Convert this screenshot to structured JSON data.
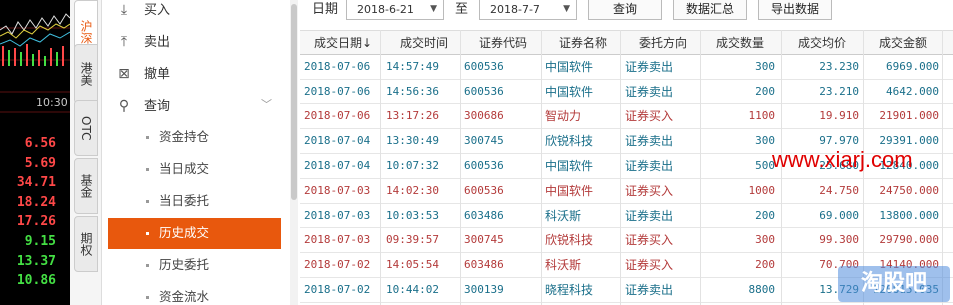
{
  "left_panel": {
    "time": "10:30",
    "prices": [
      "6.56",
      "5.69",
      "34.71",
      "18.24",
      "17.26",
      "9.15",
      "13.37",
      "10.86"
    ],
    "price_colors": [
      "#ff4848",
      "#ff4848",
      "#ff4848",
      "#ff4848",
      "#ff4848",
      "#44e044",
      "#44e044",
      "#44e044"
    ]
  },
  "vtabs": [
    {
      "label": "沪深",
      "active": true
    },
    {
      "label": "港美",
      "active": false
    },
    {
      "label": "OTC",
      "active": false
    },
    {
      "label": "基金",
      "active": false
    },
    {
      "label": "期权",
      "active": false
    }
  ],
  "menu": {
    "items": [
      {
        "label": "买入",
        "icon": "download-icon"
      },
      {
        "label": "卖出",
        "icon": "upload-icon"
      },
      {
        "label": "撤单",
        "icon": "cancel-box-icon"
      },
      {
        "label": "查询",
        "icon": "search-icon"
      }
    ],
    "sub_items": [
      "资金持仓",
      "当日成交",
      "当日委托",
      "历史成交",
      "历史委托",
      "资金流水"
    ],
    "active_sub": "历史成交"
  },
  "filter": {
    "date_label": "日期",
    "start_date": "2018-6-21",
    "to_label": "至",
    "end_date": "2018-7-7",
    "query_button": "查询",
    "summary_button": "数据汇总",
    "export_button": "导出数据"
  },
  "table": {
    "headers": [
      "成交日期↓",
      "成交时间",
      "证券代码",
      "证券名称",
      "委托方向",
      "成交数量",
      "成交均价",
      "成交金额"
    ],
    "rows": [
      [
        "2018-07-06",
        "14:57:49",
        "600536",
        "中国软件",
        "证券卖出",
        "300",
        "23.230",
        "6969.000"
      ],
      [
        "2018-07-06",
        "14:56:36",
        "600536",
        "中国软件",
        "证券卖出",
        "200",
        "23.210",
        "4642.000"
      ],
      [
        "2018-07-06",
        "13:17:26",
        "300686",
        "智动力",
        "证券买入",
        "1100",
        "19.910",
        "21901.000"
      ],
      [
        "2018-07-04",
        "13:30:49",
        "300745",
        "欣锐科技",
        "证券卖出",
        "300",
        "97.970",
        "29391.000"
      ],
      [
        "2018-07-04",
        "10:07:32",
        "600536",
        "中国软件",
        "证券卖出",
        "500",
        "25.680",
        "12840.000"
      ],
      [
        "2018-07-03",
        "14:02:30",
        "600536",
        "中国软件",
        "证券买入",
        "1000",
        "24.750",
        "24750.000"
      ],
      [
        "2018-07-03",
        "10:03:53",
        "603486",
        "科沃斯",
        "证券卖出",
        "200",
        "69.000",
        "13800.000"
      ],
      [
        "2018-07-03",
        "09:39:57",
        "300745",
        "欣锐科技",
        "证券买入",
        "300",
        "99.300",
        "29790.000"
      ],
      [
        "2018-07-02",
        "14:05:54",
        "603486",
        "科沃斯",
        "证券买入",
        "200",
        "70.700",
        "14140.000"
      ],
      [
        "2018-07-02",
        "10:44:02",
        "300139",
        "晓程科技",
        "证券卖出",
        "8800",
        "13.729",
        "120815.035"
      ]
    ]
  },
  "watermark_url": "www.xiarj.com",
  "watermark_badge": "淘股吧",
  "colors": {
    "accent": "#e8580d",
    "sell": "#1a6f8a",
    "buy": "#b33a3a",
    "up": "#ff4848",
    "down": "#44e044"
  }
}
